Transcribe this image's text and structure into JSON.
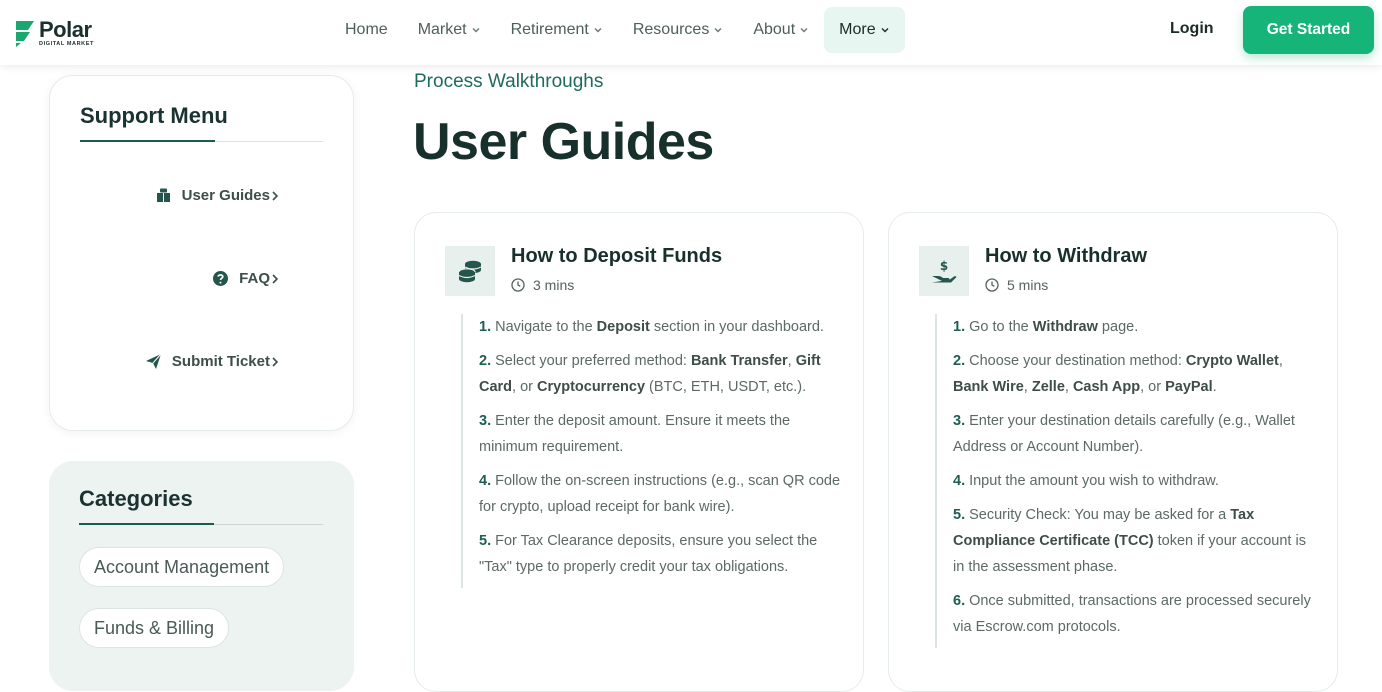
{
  "header": {
    "logo": {
      "word": "Polar",
      "sub": "DIGITAL MARKET"
    },
    "nav": [
      {
        "label": "Home",
        "dropdown": false,
        "active": false
      },
      {
        "label": "Market",
        "dropdown": true,
        "active": false
      },
      {
        "label": "Retirement",
        "dropdown": true,
        "active": false
      },
      {
        "label": "Resources",
        "dropdown": true,
        "active": false
      },
      {
        "label": "About",
        "dropdown": true,
        "active": false
      },
      {
        "label": "More",
        "dropdown": true,
        "active": true
      }
    ],
    "login_label": "Login",
    "cta_label": "Get Started"
  },
  "sidebar": {
    "support_title": "Support Menu",
    "links": [
      {
        "label": "User Guides",
        "icon": "book-icon"
      },
      {
        "label": "FAQ",
        "icon": "question-circle-icon"
      },
      {
        "label": "Submit Ticket",
        "icon": "paper-plane-icon"
      }
    ],
    "categories_title": "Categories",
    "categories": [
      "Account Management",
      "Funds & Billing"
    ]
  },
  "main": {
    "eyebrow": "Process Walkthroughs",
    "title": "User Guides"
  },
  "guides": [
    {
      "title": "How to Deposit Funds",
      "time": "3 mins",
      "icon": "coins-icon",
      "steps": [
        {
          "num": "1.",
          "parts": [
            {
              "t": "Navigate to the "
            },
            {
              "t": "Deposit",
              "b": true
            },
            {
              "t": " section in your dashboard."
            }
          ]
        },
        {
          "num": "2.",
          "parts": [
            {
              "t": "Select your preferred method: "
            },
            {
              "t": "Bank Transfer",
              "b": true
            },
            {
              "t": ", "
            },
            {
              "t": "Gift Card",
              "b": true
            },
            {
              "t": ", or "
            },
            {
              "t": "Cryptocurrency",
              "b": true
            },
            {
              "t": " (BTC, ETH, USDT, etc.)."
            }
          ]
        },
        {
          "num": "3.",
          "parts": [
            {
              "t": "Enter the deposit amount. Ensure it meets the minimum requirement."
            }
          ]
        },
        {
          "num": "4.",
          "parts": [
            {
              "t": "Follow the on-screen instructions (e.g., scan QR code for crypto, upload receipt for bank wire)."
            }
          ]
        },
        {
          "num": "5.",
          "parts": [
            {
              "t": "For Tax Clearance deposits, ensure you select the \"Tax\" type to properly credit your tax obligations."
            }
          ]
        }
      ]
    },
    {
      "title": "How to Withdraw",
      "time": "5 mins",
      "icon": "hand-dollar-icon",
      "steps": [
        {
          "num": "1.",
          "parts": [
            {
              "t": "Go to the "
            },
            {
              "t": "Withdraw",
              "b": true
            },
            {
              "t": " page."
            }
          ]
        },
        {
          "num": "2.",
          "parts": [
            {
              "t": "Choose your destination method: "
            },
            {
              "t": "Crypto Wallet",
              "b": true
            },
            {
              "t": ", "
            },
            {
              "t": "Bank Wire",
              "b": true
            },
            {
              "t": ", "
            },
            {
              "t": "Zelle",
              "b": true
            },
            {
              "t": ", "
            },
            {
              "t": "Cash App",
              "b": true
            },
            {
              "t": ", or "
            },
            {
              "t": "PayPal",
              "b": true
            },
            {
              "t": "."
            }
          ]
        },
        {
          "num": "3.",
          "parts": [
            {
              "t": "Enter your destination details carefully (e.g., Wallet Address or Account Number)."
            }
          ]
        },
        {
          "num": "4.",
          "parts": [
            {
              "t": "Input the amount you wish to withdraw."
            }
          ]
        },
        {
          "num": "5.",
          "parts": [
            {
              "t": "Security Check: You may be asked for a "
            },
            {
              "t": "Tax Compliance Certificate (TCC)",
              "b": true
            },
            {
              "t": " token if your account is in the assessment phase."
            }
          ]
        },
        {
          "num": "6.",
          "parts": [
            {
              "t": "Once submitted, transactions are processed securely via Escrow.com protocols."
            }
          ]
        }
      ]
    }
  ],
  "colors": {
    "brand": "#17b47a",
    "accent": "#1c5b50",
    "nav_active_bg": "#e8f6f1"
  }
}
